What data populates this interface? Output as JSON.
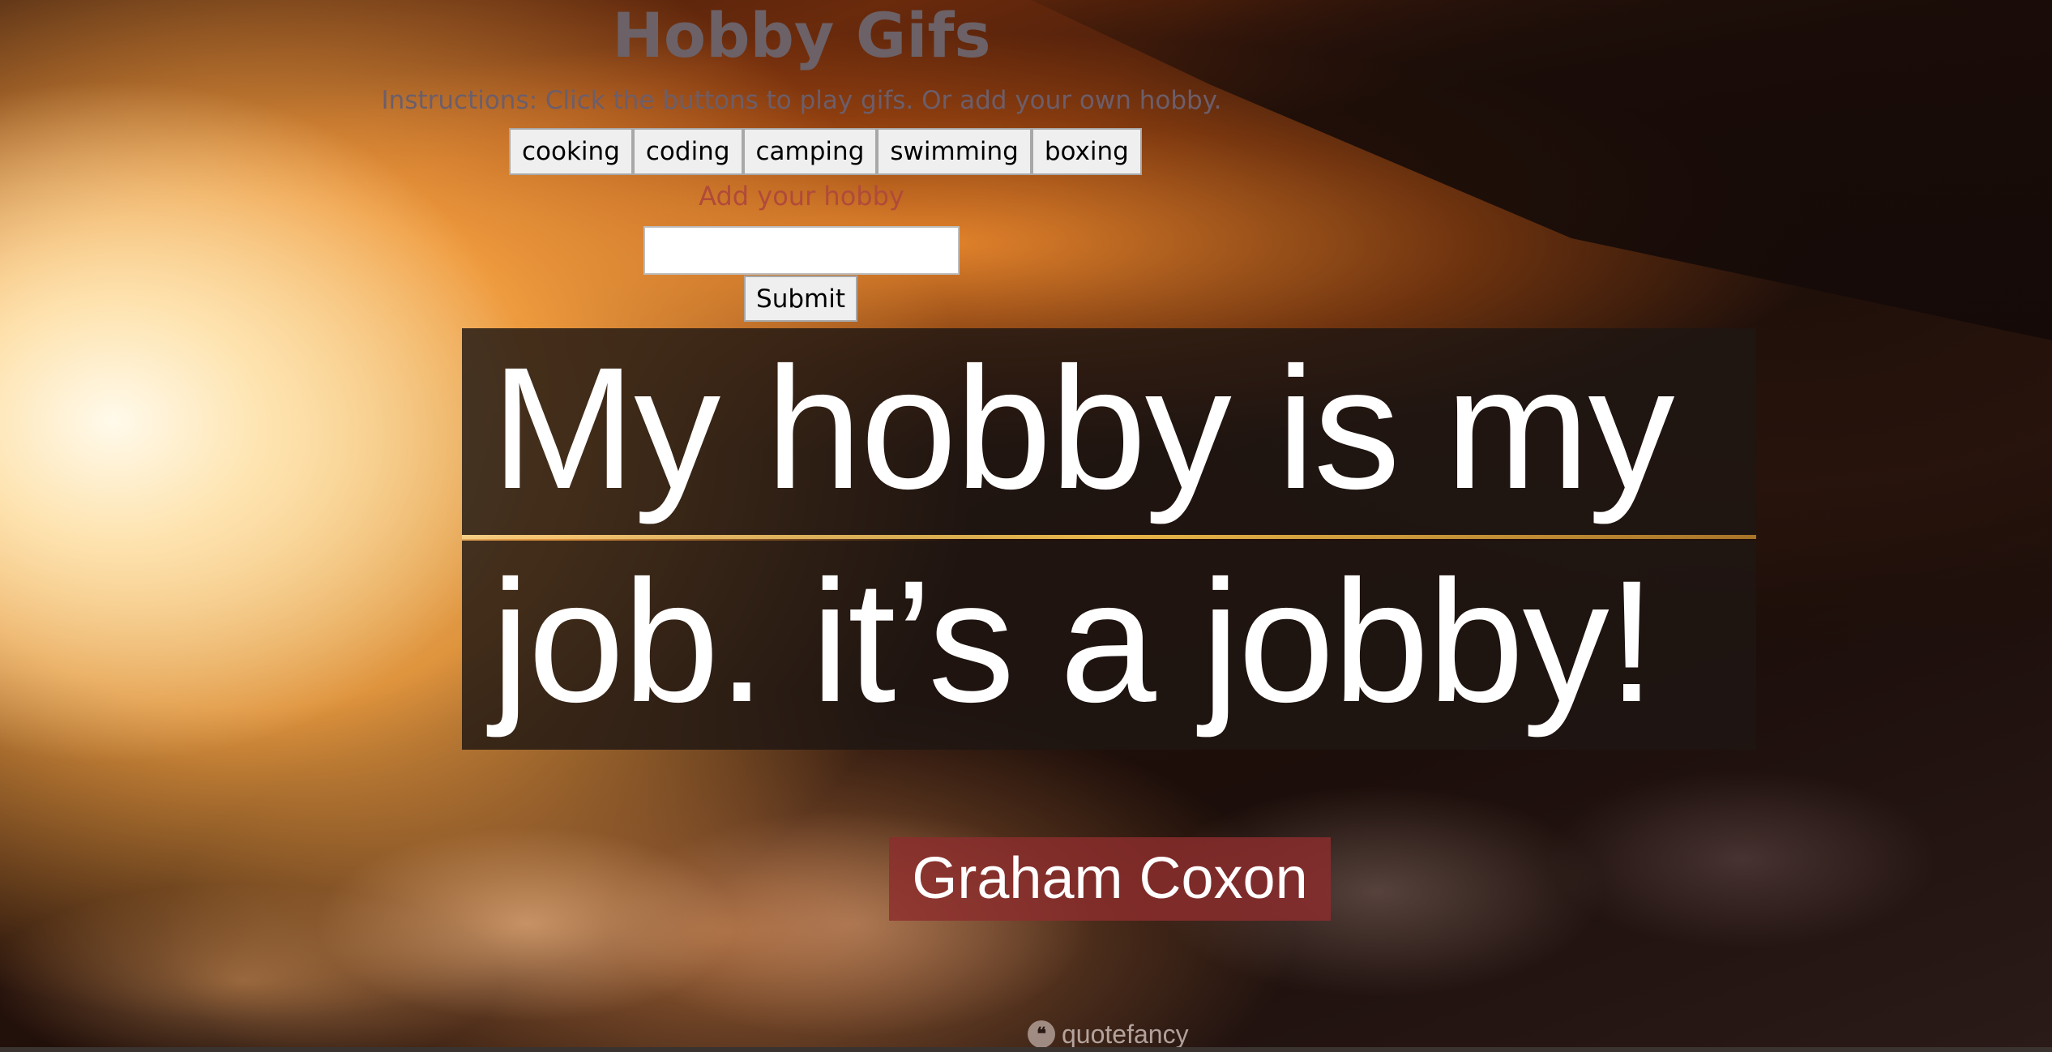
{
  "header": {
    "title": "Hobby Gifs",
    "instructions": "Instructions: Click the buttons to play gifs. Or add your own hobby."
  },
  "hobby_buttons": [
    {
      "label": "cooking"
    },
    {
      "label": "coding"
    },
    {
      "label": "camping"
    },
    {
      "label": "swimming"
    },
    {
      "label": "boxing"
    }
  ],
  "form": {
    "label": "Add your hobby",
    "input_value": "",
    "input_placeholder": "",
    "submit_label": "Submit"
  },
  "quote_image": {
    "line1": "My hobby is my",
    "line2": "job. it’s a jobby!",
    "author": "Graham Coxon",
    "brand_icon": "quote-icon",
    "brand_glyph": "❝",
    "brand_name": "quotefancy"
  },
  "colors": {
    "title": "#6c6166",
    "label": "#b04a3a",
    "author_bg": "#8c2d2d"
  }
}
